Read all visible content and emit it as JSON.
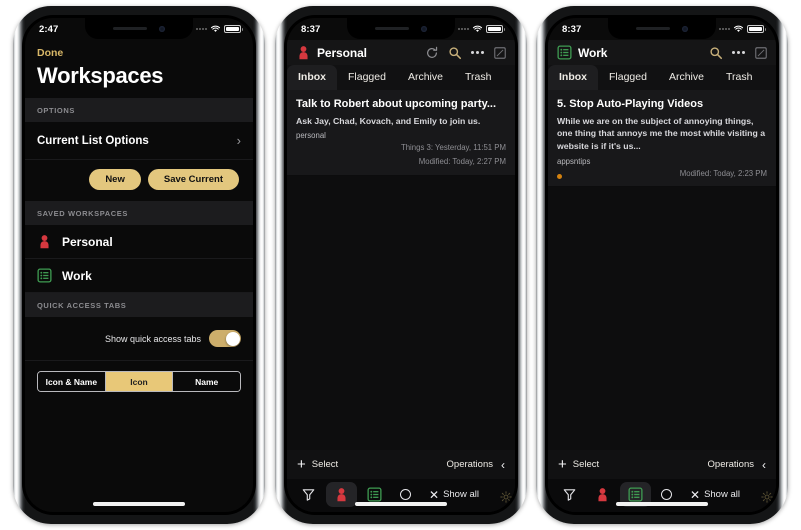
{
  "phone1": {
    "status": {
      "time": "2:47"
    },
    "nav": {
      "done_label": "Done",
      "page_title": "Workspaces"
    },
    "sections": {
      "options_header": "OPTIONS",
      "saved_header": "SAVED WORKSPACES",
      "quick_header": "QUICK ACCESS TABS"
    },
    "current_list_options": "Current List Options",
    "buttons": {
      "new_label": "New",
      "save_current_label": "Save Current"
    },
    "workspaces": [
      {
        "name": "Personal",
        "icon": "person-icon",
        "color": "#d6383f"
      },
      {
        "name": "Work",
        "icon": "list-icon",
        "color": "#3f9c52"
      }
    ],
    "quick_access": {
      "toggle_label": "Show quick access tabs",
      "toggle_on": true,
      "segments": [
        {
          "label": "Icon & Name",
          "selected": false
        },
        {
          "label": "Icon",
          "selected": true
        },
        {
          "label": "Name",
          "selected": false
        }
      ]
    }
  },
  "phone2": {
    "status": {
      "time": "8:37"
    },
    "header": {
      "title": "Personal",
      "icon": "person-icon",
      "icon_color": "#d6383f",
      "actions": [
        "refresh-icon",
        "search-icon",
        "more-icon",
        "window-icon"
      ]
    },
    "tabs": [
      {
        "label": "Inbox",
        "active": true
      },
      {
        "label": "Flagged",
        "active": false
      },
      {
        "label": "Archive",
        "active": false
      },
      {
        "label": "Trash",
        "active": false
      }
    ],
    "note": {
      "title": "Talk to Robert about upcoming party...",
      "body": "Ask Jay, Chad, Kovach, and Emily to join us.",
      "tag": "personal",
      "meta_line1": "Things 3: Yesterday, 11:51 PM",
      "meta_line2": "Modified: Today, 2:27 PM"
    },
    "bottom": {
      "add_label": "",
      "select_label": "Select",
      "operations_label": "Operations"
    },
    "tabbar": [
      {
        "name": "filter-icon",
        "label": "",
        "active": false
      },
      {
        "name": "person-icon",
        "label": "",
        "active": true
      },
      {
        "name": "list-icon",
        "label": "",
        "active": false
      },
      {
        "name": "circle-icon",
        "label": "",
        "active": false
      },
      {
        "name": "show-all",
        "label": "Show all",
        "active": false
      }
    ]
  },
  "phone3": {
    "status": {
      "time": "8:37"
    },
    "header": {
      "title": "Work",
      "icon": "list-icon",
      "icon_color": "#3f9c52",
      "actions": [
        "search-icon",
        "more-icon",
        "window-icon"
      ]
    },
    "tabs": [
      {
        "label": "Inbox",
        "active": true
      },
      {
        "label": "Flagged",
        "active": false
      },
      {
        "label": "Archive",
        "active": false
      },
      {
        "label": "Trash",
        "active": false
      }
    ],
    "note": {
      "title": "5. Stop Auto-Playing Videos",
      "body": "While we are on the subject of annoying things, one thing that annoys me the most while visiting a website is if it's us...",
      "tag": "appsntips",
      "meta_line2": "Modified: Today, 2:23 PM",
      "dot_color": "#d4820f"
    },
    "bottom": {
      "select_label": "Select",
      "operations_label": "Operations"
    },
    "tabbar": [
      {
        "name": "filter-icon",
        "label": "",
        "active": false
      },
      {
        "name": "person-icon",
        "label": "",
        "active": false
      },
      {
        "name": "list-icon",
        "label": "",
        "active": true
      },
      {
        "name": "circle-icon",
        "label": "",
        "active": false
      },
      {
        "name": "show-all",
        "label": "Show all",
        "active": false
      }
    ]
  },
  "theme": {
    "accent_gold": "#e3c77e",
    "red": "#d6383f",
    "green": "#3f9c52",
    "orange": "#d4820f"
  }
}
